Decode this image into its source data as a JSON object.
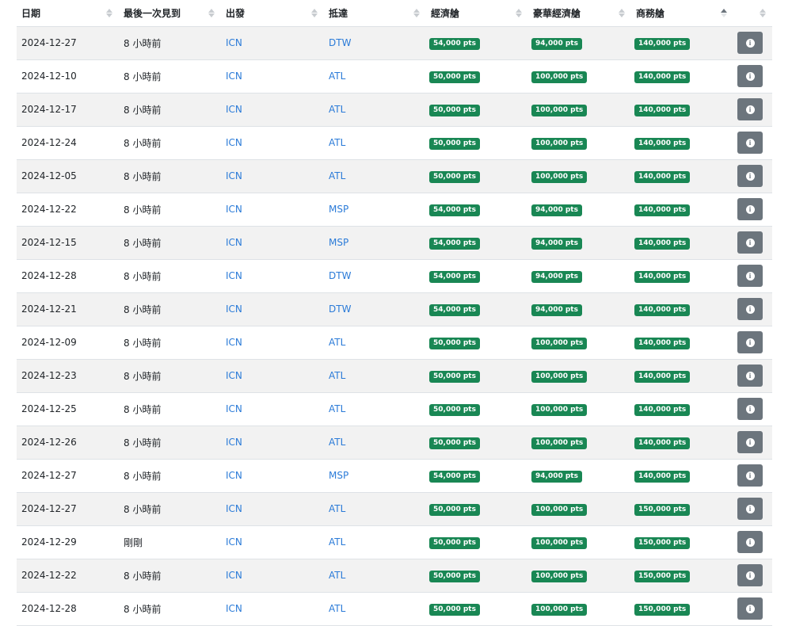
{
  "table": {
    "headers": {
      "date": "日期",
      "last_seen": "最後一次見到",
      "origin": "出發",
      "destination": "抵達",
      "economy": "經濟艙",
      "premium": "豪華經濟艙",
      "business": "商務艙"
    },
    "sorted_column": "business",
    "rows": [
      {
        "date": "2024-12-27",
        "last_seen": "8 小時前",
        "origin": "ICN",
        "destination": "DTW",
        "economy": "54,000 pts",
        "premium": "94,000 pts",
        "business": "140,000 pts"
      },
      {
        "date": "2024-12-10",
        "last_seen": "8 小時前",
        "origin": "ICN",
        "destination": "ATL",
        "economy": "50,000 pts",
        "premium": "100,000 pts",
        "business": "140,000 pts"
      },
      {
        "date": "2024-12-17",
        "last_seen": "8 小時前",
        "origin": "ICN",
        "destination": "ATL",
        "economy": "50,000 pts",
        "premium": "100,000 pts",
        "business": "140,000 pts"
      },
      {
        "date": "2024-12-24",
        "last_seen": "8 小時前",
        "origin": "ICN",
        "destination": "ATL",
        "economy": "50,000 pts",
        "premium": "100,000 pts",
        "business": "140,000 pts"
      },
      {
        "date": "2024-12-05",
        "last_seen": "8 小時前",
        "origin": "ICN",
        "destination": "ATL",
        "economy": "50,000 pts",
        "premium": "100,000 pts",
        "business": "140,000 pts"
      },
      {
        "date": "2024-12-22",
        "last_seen": "8 小時前",
        "origin": "ICN",
        "destination": "MSP",
        "economy": "54,000 pts",
        "premium": "94,000 pts",
        "business": "140,000 pts"
      },
      {
        "date": "2024-12-15",
        "last_seen": "8 小時前",
        "origin": "ICN",
        "destination": "MSP",
        "economy": "54,000 pts",
        "premium": "94,000 pts",
        "business": "140,000 pts"
      },
      {
        "date": "2024-12-28",
        "last_seen": "8 小時前",
        "origin": "ICN",
        "destination": "DTW",
        "economy": "54,000 pts",
        "premium": "94,000 pts",
        "business": "140,000 pts"
      },
      {
        "date": "2024-12-21",
        "last_seen": "8 小時前",
        "origin": "ICN",
        "destination": "DTW",
        "economy": "54,000 pts",
        "premium": "94,000 pts",
        "business": "140,000 pts"
      },
      {
        "date": "2024-12-09",
        "last_seen": "8 小時前",
        "origin": "ICN",
        "destination": "ATL",
        "economy": "50,000 pts",
        "premium": "100,000 pts",
        "business": "140,000 pts"
      },
      {
        "date": "2024-12-23",
        "last_seen": "8 小時前",
        "origin": "ICN",
        "destination": "ATL",
        "economy": "50,000 pts",
        "premium": "100,000 pts",
        "business": "140,000 pts"
      },
      {
        "date": "2024-12-25",
        "last_seen": "8 小時前",
        "origin": "ICN",
        "destination": "ATL",
        "economy": "50,000 pts",
        "premium": "100,000 pts",
        "business": "140,000 pts"
      },
      {
        "date": "2024-12-26",
        "last_seen": "8 小時前",
        "origin": "ICN",
        "destination": "ATL",
        "economy": "50,000 pts",
        "premium": "100,000 pts",
        "business": "140,000 pts"
      },
      {
        "date": "2024-12-27",
        "last_seen": "8 小時前",
        "origin": "ICN",
        "destination": "MSP",
        "economy": "54,000 pts",
        "premium": "94,000 pts",
        "business": "140,000 pts"
      },
      {
        "date": "2024-12-27",
        "last_seen": "8 小時前",
        "origin": "ICN",
        "destination": "ATL",
        "economy": "50,000 pts",
        "premium": "100,000 pts",
        "business": "150,000 pts"
      },
      {
        "date": "2024-12-29",
        "last_seen": "剛剛",
        "origin": "ICN",
        "destination": "ATL",
        "economy": "50,000 pts",
        "premium": "100,000 pts",
        "business": "150,000 pts"
      },
      {
        "date": "2024-12-22",
        "last_seen": "8 小時前",
        "origin": "ICN",
        "destination": "ATL",
        "economy": "50,000 pts",
        "premium": "100,000 pts",
        "business": "150,000 pts"
      },
      {
        "date": "2024-12-28",
        "last_seen": "8 小時前",
        "origin": "ICN",
        "destination": "ATL",
        "economy": "50,000 pts",
        "premium": "100,000 pts",
        "business": "150,000 pts"
      }
    ]
  },
  "icons": {
    "sort": "sort-icon",
    "info": "info-icon"
  },
  "colors": {
    "badge": "#198754",
    "link": "#2b7bd8",
    "info_button": "#6c757d",
    "stripe": "#f2f2f2"
  }
}
